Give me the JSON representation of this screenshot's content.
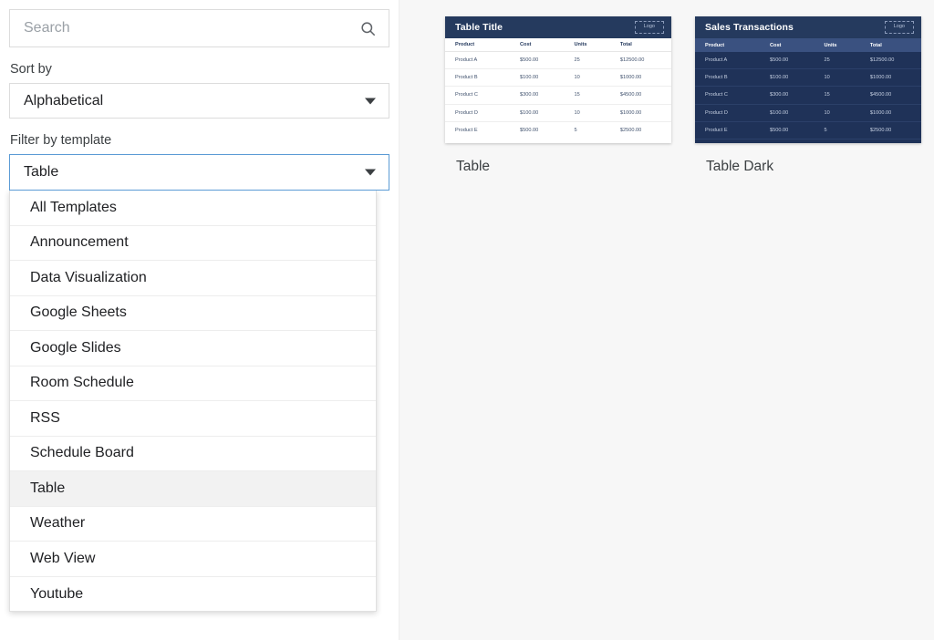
{
  "search": {
    "placeholder": "Search",
    "value": "",
    "icon": "search-icon"
  },
  "sort": {
    "label": "Sort by",
    "selected": "Alphabetical",
    "icon": "chevron-down-icon"
  },
  "filter": {
    "label": "Filter by template",
    "selected": "Table",
    "icon": "chevron-down-icon",
    "options": [
      "All Templates",
      "Announcement",
      "Data Visualization",
      "Google Sheets",
      "Google Slides",
      "Room Schedule",
      "RSS",
      "Schedule Board",
      "Table",
      "Weather",
      "Web View",
      "Youtube"
    ],
    "selected_index": 8
  },
  "colors": {
    "focus_border": "#5b9bd5",
    "table_header_navy": "#253a5e",
    "dark_body": "#1f3258",
    "dark_header_row": "#3a5180",
    "panel_background": "#f7f7f7"
  },
  "templates": [
    {
      "name": "Table",
      "theme": "light",
      "title": "Table Title",
      "logo_label": "Logo",
      "columns": [
        "Product",
        "Cost",
        "Units",
        "Total"
      ],
      "rows": [
        [
          "Product A",
          "$500.00",
          "25",
          "$12500.00"
        ],
        [
          "Product B",
          "$100.00",
          "10",
          "$1000.00"
        ],
        [
          "Product C",
          "$300.00",
          "15",
          "$4500.00"
        ],
        [
          "Product D",
          "$100.00",
          "10",
          "$1000.00"
        ],
        [
          "Product E",
          "$500.00",
          "5",
          "$2500.00"
        ]
      ]
    },
    {
      "name": "Table Dark",
      "theme": "dark",
      "title": "Sales Transactions",
      "logo_label": "Logo",
      "columns": [
        "Product",
        "Cost",
        "Units",
        "Total"
      ],
      "rows": [
        [
          "Product A",
          "$500.00",
          "25",
          "$12500.00"
        ],
        [
          "Product B",
          "$100.00",
          "10",
          "$1000.00"
        ],
        [
          "Product C",
          "$300.00",
          "15",
          "$4500.00"
        ],
        [
          "Product D",
          "$100.00",
          "10",
          "$1000.00"
        ],
        [
          "Product E",
          "$500.00",
          "5",
          "$2500.00"
        ]
      ]
    }
  ]
}
